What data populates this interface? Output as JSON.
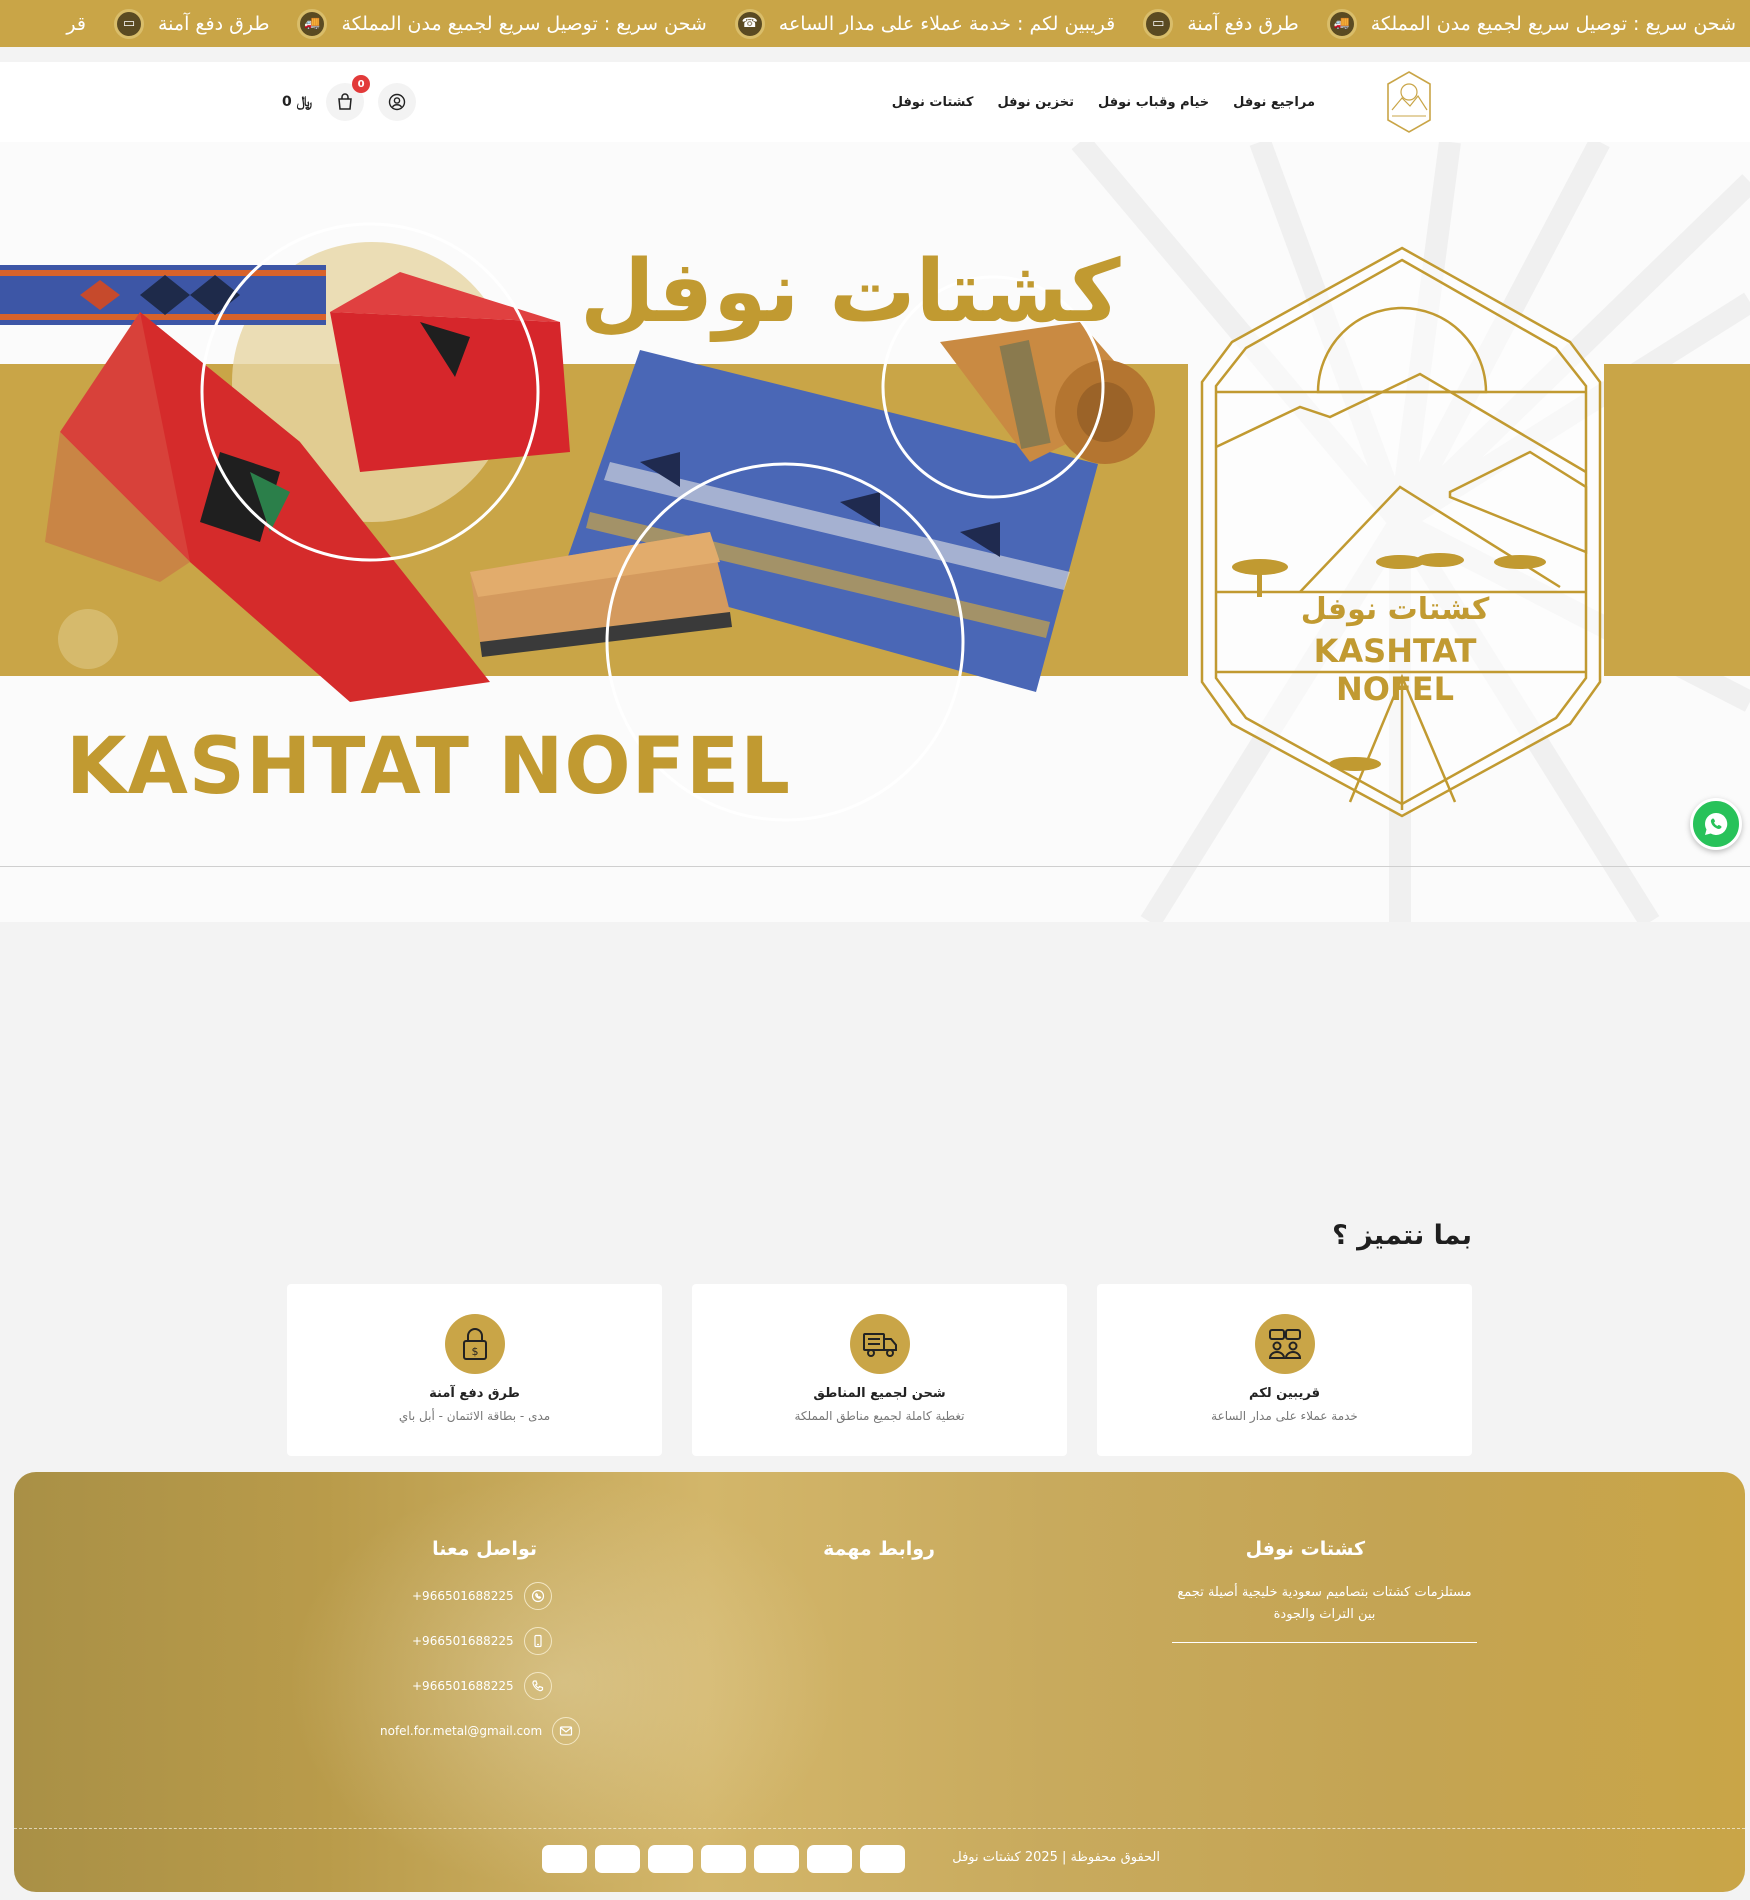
{
  "ticker": {
    "items": [
      {
        "text": "شحن سريع : توصيل سريع لجميع مدن المملكة",
        "icon": "truck-icon"
      },
      {
        "text": "طرق دفع آمنة",
        "icon": "card-icon"
      },
      {
        "text": "قريبين لكم : خدمة عملاء على مدار الساعه",
        "icon": "support-icon"
      },
      {
        "text": "شحن سريع : توصيل سريع لجميع مدن المملكة",
        "icon": "truck-icon"
      },
      {
        "text": "طرق دفع آمنة",
        "icon": "card-icon"
      },
      {
        "text": "قر",
        "icon": "support-icon"
      }
    ]
  },
  "header": {
    "nav": [
      "مراجيع نوفل",
      "خيام وقباب نوفل",
      "تخزين نوفل",
      "كشتات نوفل"
    ],
    "cart_count": "0",
    "cart_total": "0 ﷼"
  },
  "hero": {
    "title_ar": "كشتات نوفل",
    "title_en": "KASHTAT NOFEL",
    "emblem_ar": "كشتات نوفل",
    "emblem_en": "KASHTAT NOFEL"
  },
  "features": {
    "heading": "بما نتميز ؟",
    "cards": [
      {
        "title": "قريبين لكم",
        "desc": "خدمة عملاء على مدار الساعة",
        "icon": "support-icon"
      },
      {
        "title": "شحن لجميع المناطق",
        "desc": "تغطية كاملة لجميع مناطق المملكة",
        "icon": "truck-icon"
      },
      {
        "title": "طرق دفع آمنة",
        "desc": "مدى - بطاقة الائتمان - أبل باي",
        "icon": "lock-icon"
      }
    ]
  },
  "footer": {
    "about_title": "كشتات نوفل",
    "about_text": "مستلزمات كشتات بتصاميم سعودية خليجية أصيلة تجمع بين التراث والجودة",
    "links_title": "روابط مهمة",
    "contact_title": "تواصل معنا",
    "contacts": [
      {
        "icon": "whatsapp-icon",
        "value": "+966501688225"
      },
      {
        "icon": "mobile-icon",
        "value": "+966501688225"
      },
      {
        "icon": "phone-icon",
        "value": "+966501688225"
      },
      {
        "icon": "mail-icon",
        "value": "nofel.for.metal@gmail.com"
      }
    ],
    "copyright": "الحقوق محفوظة | 2025 كشتات نوفل",
    "payment_methods_count": 7
  },
  "colors": {
    "gold": "#c9a547",
    "dark_gold": "#c19a31",
    "whatsapp": "#28c25a",
    "badge_red": "#e23a3a"
  }
}
